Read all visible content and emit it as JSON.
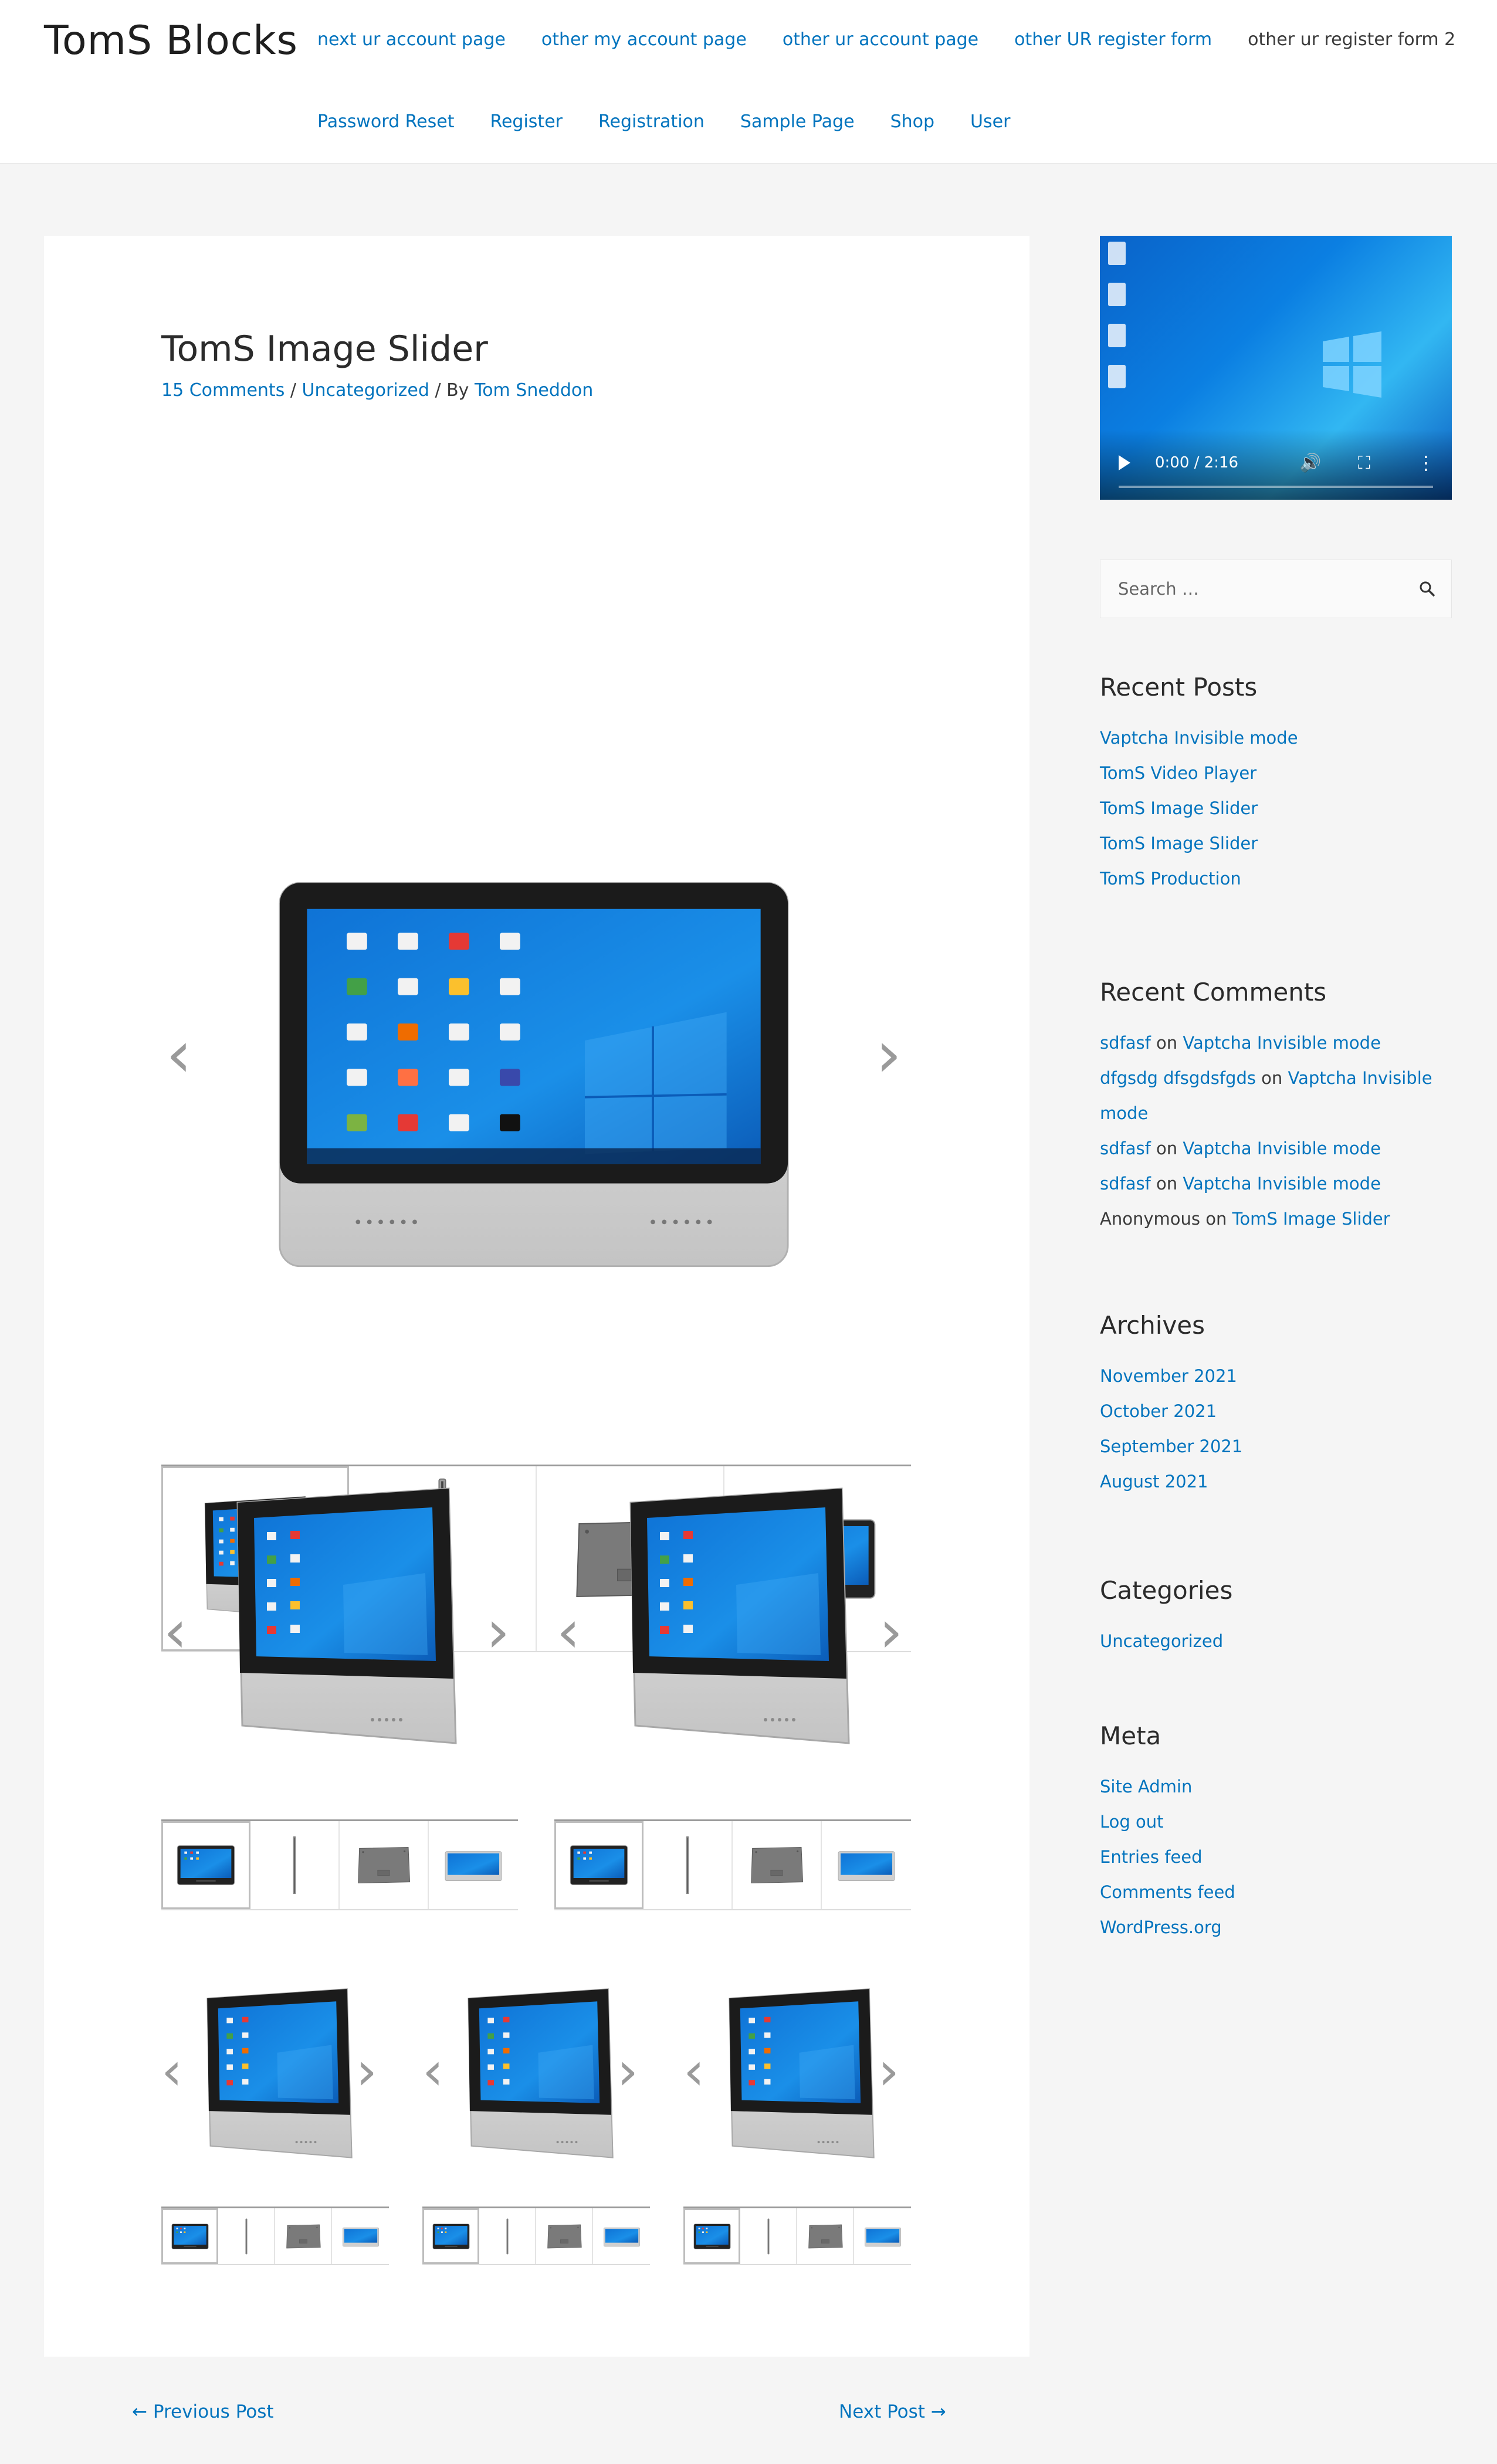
{
  "site": {
    "title": "TomS Blocks"
  },
  "nav": {
    "row1": [
      {
        "label": "next ur account page",
        "current": false
      },
      {
        "label": "other my account page",
        "current": false
      },
      {
        "label": "other ur account page",
        "current": false
      },
      {
        "label": "other UR register form",
        "current": false
      },
      {
        "label": "other ur register form 2",
        "current": true
      }
    ],
    "row2": [
      {
        "label": "Password Reset"
      },
      {
        "label": "Register"
      },
      {
        "label": "Registration"
      },
      {
        "label": "Sample Page"
      },
      {
        "label": "Shop"
      },
      {
        "label": "User"
      }
    ]
  },
  "post": {
    "title": "TomS Image Slider",
    "comments_link": "15 Comments",
    "sep1": " / ",
    "category": "Uncategorized",
    "by_text": " / By ",
    "author": "Tom Sneddon"
  },
  "slider": {
    "prev_glyph": "‹",
    "next_glyph": "›"
  },
  "video": {
    "time": "0:00 / 2:16"
  },
  "search": {
    "placeholder": "Search …"
  },
  "recent_posts": {
    "title": "Recent Posts",
    "items": [
      "Vaptcha Invisible mode",
      "TomS Video Player",
      "TomS Image Slider",
      "TomS Image Slider",
      "TomS Production"
    ]
  },
  "recent_comments": {
    "title": "Recent Comments",
    "on": " on ",
    "items": [
      {
        "author": "sdfasf",
        "post": "Vaptcha Invisible mode"
      },
      {
        "author": "dfgsdg dfsgdsfgds",
        "post": "Vaptcha Invisible mode"
      },
      {
        "author": "sdfasf",
        "post": "Vaptcha Invisible mode"
      },
      {
        "author": "sdfasf",
        "post": "Vaptcha Invisible mode"
      },
      {
        "author": "Anonymous",
        "post": "TomS Image Slider"
      }
    ]
  },
  "archives": {
    "title": "Archives",
    "items": [
      "November 2021",
      "October 2021",
      "September 2021",
      "August 2021"
    ]
  },
  "categories": {
    "title": "Categories",
    "items": [
      "Uncategorized"
    ]
  },
  "meta": {
    "title": "Meta",
    "items": [
      "Site Admin",
      "Log out",
      "Entries feed",
      "Comments feed",
      "WordPress.org"
    ]
  },
  "post_nav": {
    "previous": "← Previous Post",
    "next": "Next Post →"
  }
}
